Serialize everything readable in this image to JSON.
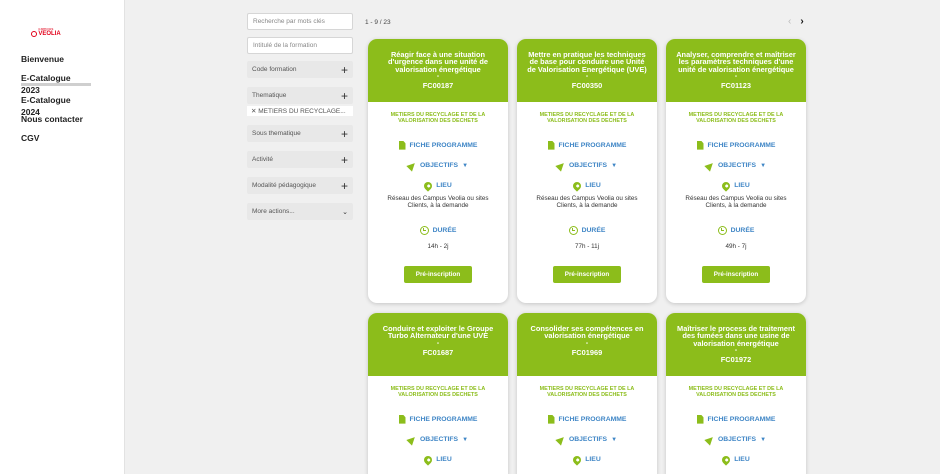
{
  "logo": {
    "small": "campus",
    "brand": "VEOLIA"
  },
  "nav": [
    {
      "label": "Bienvenue"
    },
    {
      "label": "E-Catalogue 2023",
      "active": true
    },
    {
      "label": "E-Catalogue 2024"
    },
    {
      "label": "Nous contacter"
    },
    {
      "label": "CGV"
    }
  ],
  "filters": {
    "search_placeholder": "Recherche par mots clés",
    "title_placeholder": "Intitulé de la formation",
    "code_label": "Code formation",
    "theme_label": "Thematique",
    "theme_chip": "✕ METIERS DU RECYCLAGE...",
    "subtheme_label": "Sous thematique",
    "activity_label": "Activité",
    "modality_label": "Modalité pédagogique",
    "more_label": "More actions...",
    "plus_glyph": "+",
    "chevron_glyph": "⌄"
  },
  "results": {
    "counter": "1 - 9 / 23",
    "prev": "‹",
    "next": "›"
  },
  "card_labels": {
    "fiche": "FICHE PROGRAMME",
    "objectifs": "OBJECTIFS",
    "objectifs_arrow": "▼",
    "lieu": "LIEU",
    "duree": "DURÉE",
    "cta": "Pré-inscription",
    "dash": "-"
  },
  "cards": [
    {
      "title": "Réagir face à une situation d'urgence dans une unité de valorisation énergétique",
      "code": "FC00187",
      "category": "METIERS DU RECYCLAGE ET DE LA VALORISATION DES DECHETS",
      "lieu": "Réseau des Campus Veolia ou sites Clients, à la demande",
      "duree": "14h - 2j"
    },
    {
      "title": "Mettre en pratique les techniques de base pour conduire une Unité de Valorisation Energétique (UVE)",
      "code": "FC00350",
      "category": "METIERS DU RECYCLAGE ET DE LA VALORISATION DES DECHETS",
      "lieu": "Réseau des Campus Veolia ou sites Clients, à la demande",
      "duree": "77h - 11j"
    },
    {
      "title": "Analyser, comprendre et maîtriser les paramètres techniques d'une unité de valorisation énergétique",
      "code": "FC01123",
      "category": "METIERS DU RECYCLAGE ET DE LA VALORISATION DES DECHETS",
      "lieu": "Réseau des Campus Veolia ou sites Clients, à la demande",
      "duree": "49h - 7j"
    },
    {
      "title": "Conduire et exploiter le Groupe Turbo Alternateur d'une UVE",
      "code": "FC01687",
      "category": "METIERS DU RECYCLAGE ET DE LA VALORISATION DES DECHETS"
    },
    {
      "title": "Consolider ses compétences en valorisation énergétique",
      "code": "FC01969",
      "category": "METIERS DU RECYCLAGE ET DE LA VALORISATION DES DECHETS"
    },
    {
      "title": "Maîtriser le process de traitement des fumées dans une usine de valorisation énergétique",
      "code": "FC01972",
      "category": "METIERS DU RECYCLAGE ET DE LA VALORISATION DES DECHETS"
    }
  ],
  "colors": {
    "accent": "#8cbd1b",
    "link": "#3f86c6",
    "brand": "#e2001a"
  }
}
